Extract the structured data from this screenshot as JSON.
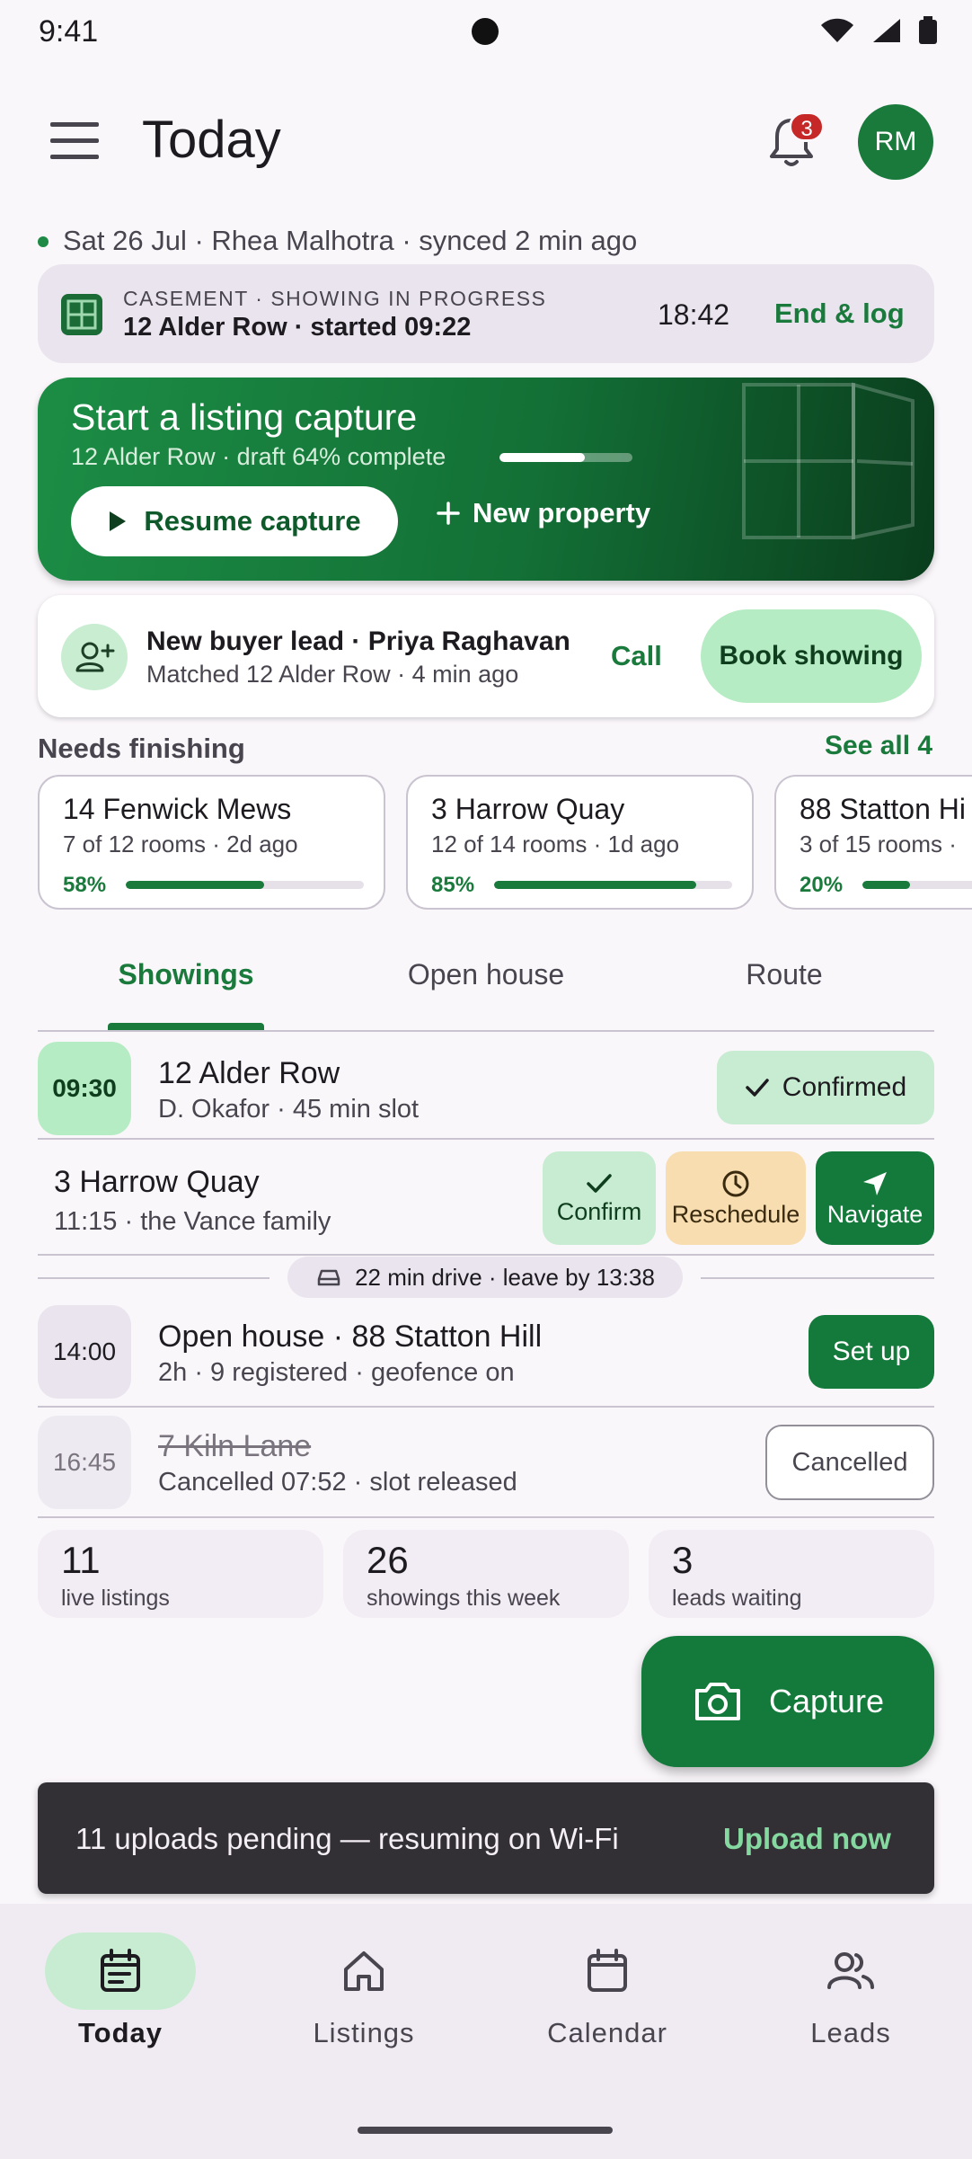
{
  "status_bar": {
    "time": "9:41"
  },
  "app_bar": {
    "title": "Today",
    "notification_count": "3",
    "avatar_initials": "RM"
  },
  "sync_line": "Sat 26 Jul · Rhea Malhotra · synced 2 min ago",
  "showing_banner": {
    "kicker": "CASEMENT · SHOWING IN PROGRESS",
    "address": "12 Alder Row · started 09:22",
    "timer": "18:42",
    "action": "End & log"
  },
  "capture_hero": {
    "title": "Start a listing capture",
    "subtitle": "12 Alder Row · draft 64% complete",
    "progress": 0.64,
    "resume_label": "Resume capture",
    "new_property_label": "New property"
  },
  "lead": {
    "title": "New buyer lead · Priya Raghavan",
    "subtitle": "Matched 12 Alder Row · 4 min ago",
    "call_label": "Call",
    "book_label": "Book showing"
  },
  "needs_finishing": {
    "title": "Needs finishing",
    "see_all": "See all 4",
    "items": [
      {
        "name": "14 Fenwick Mews",
        "meta": "7 of 12 rooms · 2d ago",
        "pct_label": "58%",
        "progress": 0.58
      },
      {
        "name": "3 Harrow Quay",
        "meta": "12 of 14 rooms · 1d ago",
        "pct_label": "85%",
        "progress": 0.85
      },
      {
        "name": "88 Statton Hi",
        "meta": "3 of 15 rooms ·",
        "pct_label": "20%",
        "progress": 0.2
      }
    ]
  },
  "tabs": [
    "Showings",
    "Open house",
    "Route"
  ],
  "showings": {
    "row1": {
      "time": "09:30",
      "title": "12 Alder Row",
      "sub": "D. Okafor · 45 min slot",
      "status": "Confirmed"
    },
    "row2": {
      "title": "3 Harrow Quay",
      "sub": "11:15 · the Vance family",
      "confirm": "Confirm",
      "reschedule": "Reschedule",
      "navigate": "Navigate"
    },
    "drive": "22 min drive · leave by 13:38",
    "row3": {
      "time": "14:00",
      "title": "Open house · 88 Statton Hill",
      "sub": "2h · 9 registered · geofence on",
      "action": "Set up"
    },
    "row4": {
      "time": "16:45",
      "title": "7 Kiln Lane",
      "sub": "Cancelled 07:52 · slot released",
      "status": "Cancelled"
    }
  },
  "stats": [
    {
      "value": "11",
      "label": "live listings"
    },
    {
      "value": "26",
      "label": "showings this week"
    },
    {
      "value": "3",
      "label": "leads waiting"
    }
  ],
  "fab_label": "Capture",
  "snackbar": {
    "text": "11 uploads pending — resuming on Wi-Fi",
    "action": "Upload now"
  },
  "bottom_nav": [
    "Today",
    "Listings",
    "Calendar",
    "Leads"
  ],
  "colors": {
    "primary": "#1a7a3c",
    "primary_container": "#c8ecd1",
    "warning_container": "#f7ddb0",
    "badge": "#c62828"
  }
}
